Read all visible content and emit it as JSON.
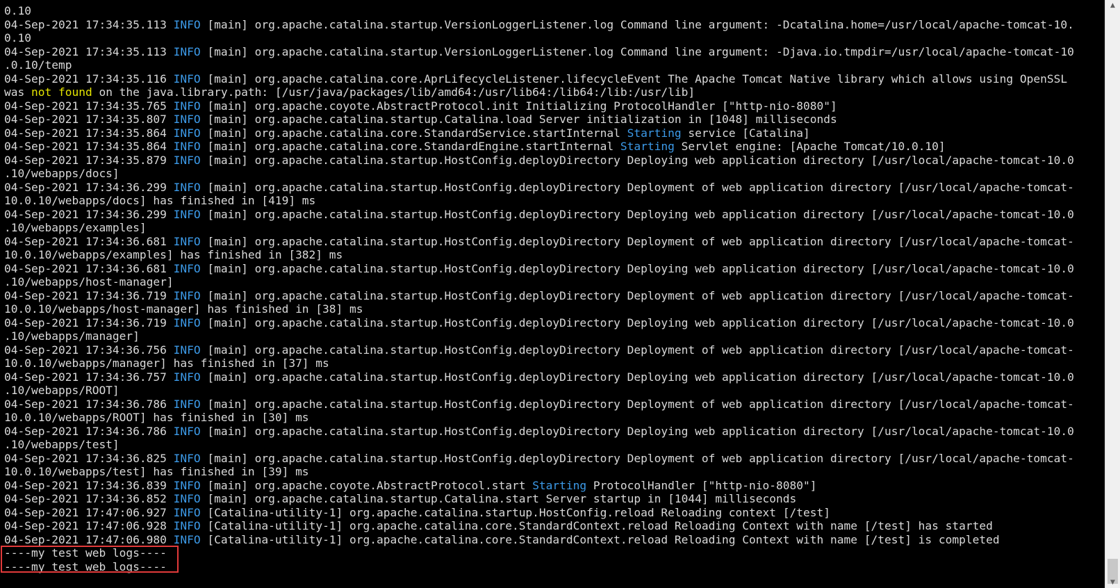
{
  "colors": {
    "background": "#000000",
    "text": "#d9d9d9",
    "info": "#3c9ae8",
    "starting": "#3c9ae8",
    "not_found": "#e5e500",
    "highlight_box": "#e23a3a"
  },
  "icons": {
    "scroll_up": "chevron-up-icon",
    "scroll_down": "chevron-down-icon"
  },
  "lines": [
    {
      "segments": [
        {
          "t": "0.10",
          "c": "text"
        }
      ]
    },
    {
      "segments": [
        {
          "t": "04-Sep-2021 17:34:35.113 ",
          "c": "text"
        },
        {
          "t": "INFO",
          "c": "info"
        },
        {
          "t": " [main] org.apache.catalina.startup.VersionLoggerListener.log Command line argument: -Dcatalina.home=/usr/local/apache-tomcat-10.",
          "c": "text"
        }
      ]
    },
    {
      "segments": [
        {
          "t": "0.10",
          "c": "text"
        }
      ]
    },
    {
      "segments": [
        {
          "t": "04-Sep-2021 17:34:35.113 ",
          "c": "text"
        },
        {
          "t": "INFO",
          "c": "info"
        },
        {
          "t": " [main] org.apache.catalina.startup.VersionLoggerListener.log Command line argument: -Djava.io.tmpdir=/usr/local/apache-tomcat-10",
          "c": "text"
        }
      ]
    },
    {
      "segments": [
        {
          "t": ".0.10/temp",
          "c": "text"
        }
      ]
    },
    {
      "segments": [
        {
          "t": "04-Sep-2021 17:34:35.116 ",
          "c": "text"
        },
        {
          "t": "INFO",
          "c": "info"
        },
        {
          "t": " [main] org.apache.catalina.core.AprLifecycleListener.lifecycleEvent The Apache Tomcat Native library which allows using OpenSSL",
          "c": "text"
        }
      ]
    },
    {
      "segments": [
        {
          "t": "was ",
          "c": "text"
        },
        {
          "t": "not found",
          "c": "not_found"
        },
        {
          "t": " on the java.library.path: [/usr/java/packages/lib/amd64:/usr/lib64:/lib64:/lib:/usr/lib]",
          "c": "text"
        }
      ]
    },
    {
      "segments": [
        {
          "t": "04-Sep-2021 17:34:35.765 ",
          "c": "text"
        },
        {
          "t": "INFO",
          "c": "info"
        },
        {
          "t": " [main] org.apache.coyote.AbstractProtocol.init Initializing ProtocolHandler [\"http-nio-8080\"]",
          "c": "text"
        }
      ]
    },
    {
      "segments": [
        {
          "t": "04-Sep-2021 17:34:35.807 ",
          "c": "text"
        },
        {
          "t": "INFO",
          "c": "info"
        },
        {
          "t": " [main] org.apache.catalina.startup.Catalina.load Server initialization in [1048] milliseconds",
          "c": "text"
        }
      ]
    },
    {
      "segments": [
        {
          "t": "04-Sep-2021 17:34:35.864 ",
          "c": "text"
        },
        {
          "t": "INFO",
          "c": "info"
        },
        {
          "t": " [main] org.apache.catalina.core.StandardService.startInternal ",
          "c": "text"
        },
        {
          "t": "Starting",
          "c": "starting"
        },
        {
          "t": " service [Catalina]",
          "c": "text"
        }
      ]
    },
    {
      "segments": [
        {
          "t": "04-Sep-2021 17:34:35.864 ",
          "c": "text"
        },
        {
          "t": "INFO",
          "c": "info"
        },
        {
          "t": " [main] org.apache.catalina.core.StandardEngine.startInternal ",
          "c": "text"
        },
        {
          "t": "Starting",
          "c": "starting"
        },
        {
          "t": " Servlet engine: [Apache Tomcat/10.0.10]",
          "c": "text"
        }
      ]
    },
    {
      "segments": [
        {
          "t": "04-Sep-2021 17:34:35.879 ",
          "c": "text"
        },
        {
          "t": "INFO",
          "c": "info"
        },
        {
          "t": " [main] org.apache.catalina.startup.HostConfig.deployDirectory Deploying web application directory [/usr/local/apache-tomcat-10.0",
          "c": "text"
        }
      ]
    },
    {
      "segments": [
        {
          "t": ".10/webapps/docs]",
          "c": "text"
        }
      ]
    },
    {
      "segments": [
        {
          "t": "04-Sep-2021 17:34:36.299 ",
          "c": "text"
        },
        {
          "t": "INFO",
          "c": "info"
        },
        {
          "t": " [main] org.apache.catalina.startup.HostConfig.deployDirectory Deployment of web application directory [/usr/local/apache-tomcat-",
          "c": "text"
        }
      ]
    },
    {
      "segments": [
        {
          "t": "10.0.10/webapps/docs] has finished in [419] ms",
          "c": "text"
        }
      ]
    },
    {
      "segments": [
        {
          "t": "04-Sep-2021 17:34:36.299 ",
          "c": "text"
        },
        {
          "t": "INFO",
          "c": "info"
        },
        {
          "t": " [main] org.apache.catalina.startup.HostConfig.deployDirectory Deploying web application directory [/usr/local/apache-tomcat-10.0",
          "c": "text"
        }
      ]
    },
    {
      "segments": [
        {
          "t": ".10/webapps/examples]",
          "c": "text"
        }
      ]
    },
    {
      "segments": [
        {
          "t": "04-Sep-2021 17:34:36.681 ",
          "c": "text"
        },
        {
          "t": "INFO",
          "c": "info"
        },
        {
          "t": " [main] org.apache.catalina.startup.HostConfig.deployDirectory Deployment of web application directory [/usr/local/apache-tomcat-",
          "c": "text"
        }
      ]
    },
    {
      "segments": [
        {
          "t": "10.0.10/webapps/examples] has finished in [382] ms",
          "c": "text"
        }
      ]
    },
    {
      "segments": [
        {
          "t": "04-Sep-2021 17:34:36.681 ",
          "c": "text"
        },
        {
          "t": "INFO",
          "c": "info"
        },
        {
          "t": " [main] org.apache.catalina.startup.HostConfig.deployDirectory Deploying web application directory [/usr/local/apache-tomcat-10.0",
          "c": "text"
        }
      ]
    },
    {
      "segments": [
        {
          "t": ".10/webapps/host-manager]",
          "c": "text"
        }
      ]
    },
    {
      "segments": [
        {
          "t": "04-Sep-2021 17:34:36.719 ",
          "c": "text"
        },
        {
          "t": "INFO",
          "c": "info"
        },
        {
          "t": " [main] org.apache.catalina.startup.HostConfig.deployDirectory Deployment of web application directory [/usr/local/apache-tomcat-",
          "c": "text"
        }
      ]
    },
    {
      "segments": [
        {
          "t": "10.0.10/webapps/host-manager] has finished in [38] ms",
          "c": "text"
        }
      ]
    },
    {
      "segments": [
        {
          "t": "04-Sep-2021 17:34:36.719 ",
          "c": "text"
        },
        {
          "t": "INFO",
          "c": "info"
        },
        {
          "t": " [main] org.apache.catalina.startup.HostConfig.deployDirectory Deploying web application directory [/usr/local/apache-tomcat-10.0",
          "c": "text"
        }
      ]
    },
    {
      "segments": [
        {
          "t": ".10/webapps/manager]",
          "c": "text"
        }
      ]
    },
    {
      "segments": [
        {
          "t": "04-Sep-2021 17:34:36.756 ",
          "c": "text"
        },
        {
          "t": "INFO",
          "c": "info"
        },
        {
          "t": " [main] org.apache.catalina.startup.HostConfig.deployDirectory Deployment of web application directory [/usr/local/apache-tomcat-",
          "c": "text"
        }
      ]
    },
    {
      "segments": [
        {
          "t": "10.0.10/webapps/manager] has finished in [37] ms",
          "c": "text"
        }
      ]
    },
    {
      "segments": [
        {
          "t": "04-Sep-2021 17:34:36.757 ",
          "c": "text"
        },
        {
          "t": "INFO",
          "c": "info"
        },
        {
          "t": " [main] org.apache.catalina.startup.HostConfig.deployDirectory Deploying web application directory [/usr/local/apache-tomcat-10.0",
          "c": "text"
        }
      ]
    },
    {
      "segments": [
        {
          "t": ".10/webapps/ROOT]",
          "c": "text"
        }
      ]
    },
    {
      "segments": [
        {
          "t": "04-Sep-2021 17:34:36.786 ",
          "c": "text"
        },
        {
          "t": "INFO",
          "c": "info"
        },
        {
          "t": " [main] org.apache.catalina.startup.HostConfig.deployDirectory Deployment of web application directory [/usr/local/apache-tomcat-",
          "c": "text"
        }
      ]
    },
    {
      "segments": [
        {
          "t": "10.0.10/webapps/ROOT] has finished in [30] ms",
          "c": "text"
        }
      ]
    },
    {
      "segments": [
        {
          "t": "04-Sep-2021 17:34:36.786 ",
          "c": "text"
        },
        {
          "t": "INFO",
          "c": "info"
        },
        {
          "t": " [main] org.apache.catalina.startup.HostConfig.deployDirectory Deploying web application directory [/usr/local/apache-tomcat-10.0",
          "c": "text"
        }
      ]
    },
    {
      "segments": [
        {
          "t": ".10/webapps/test]",
          "c": "text"
        }
      ]
    },
    {
      "segments": [
        {
          "t": "04-Sep-2021 17:34:36.825 ",
          "c": "text"
        },
        {
          "t": "INFO",
          "c": "info"
        },
        {
          "t": " [main] org.apache.catalina.startup.HostConfig.deployDirectory Deployment of web application directory [/usr/local/apache-tomcat-",
          "c": "text"
        }
      ]
    },
    {
      "segments": [
        {
          "t": "10.0.10/webapps/test] has finished in [39] ms",
          "c": "text"
        }
      ]
    },
    {
      "segments": [
        {
          "t": "04-Sep-2021 17:34:36.839 ",
          "c": "text"
        },
        {
          "t": "INFO",
          "c": "info"
        },
        {
          "t": " [main] org.apache.coyote.AbstractProtocol.start ",
          "c": "text"
        },
        {
          "t": "Starting",
          "c": "starting"
        },
        {
          "t": " ProtocolHandler [\"http-nio-8080\"]",
          "c": "text"
        }
      ]
    },
    {
      "segments": [
        {
          "t": "04-Sep-2021 17:34:36.852 ",
          "c": "text"
        },
        {
          "t": "INFO",
          "c": "info"
        },
        {
          "t": " [main] org.apache.catalina.startup.Catalina.start Server startup in [1044] milliseconds",
          "c": "text"
        }
      ]
    },
    {
      "segments": [
        {
          "t": "04-Sep-2021 17:47:06.927 ",
          "c": "text"
        },
        {
          "t": "INFO",
          "c": "info"
        },
        {
          "t": " [Catalina-utility-1] org.apache.catalina.startup.HostConfig.reload Reloading context [/test]",
          "c": "text"
        }
      ]
    },
    {
      "segments": [
        {
          "t": "04-Sep-2021 17:47:06.928 ",
          "c": "text"
        },
        {
          "t": "INFO",
          "c": "info"
        },
        {
          "t": " [Catalina-utility-1] org.apache.catalina.core.StandardContext.reload Reloading Context with name [/test] has started",
          "c": "text"
        }
      ]
    },
    {
      "segments": [
        {
          "t": "04-Sep-2021 17:47:06.980 ",
          "c": "text"
        },
        {
          "t": "INFO",
          "c": "info"
        },
        {
          "t": " [Catalina-utility-1] org.apache.catalina.core.StandardContext.reload Reloading Context with name [/test] is completed",
          "c": "text"
        }
      ]
    },
    {
      "segments": [
        {
          "t": "----my test web logs----",
          "c": "text"
        }
      ]
    },
    {
      "segments": [
        {
          "t": "----my test web logs----",
          "c": "text"
        }
      ]
    }
  ]
}
